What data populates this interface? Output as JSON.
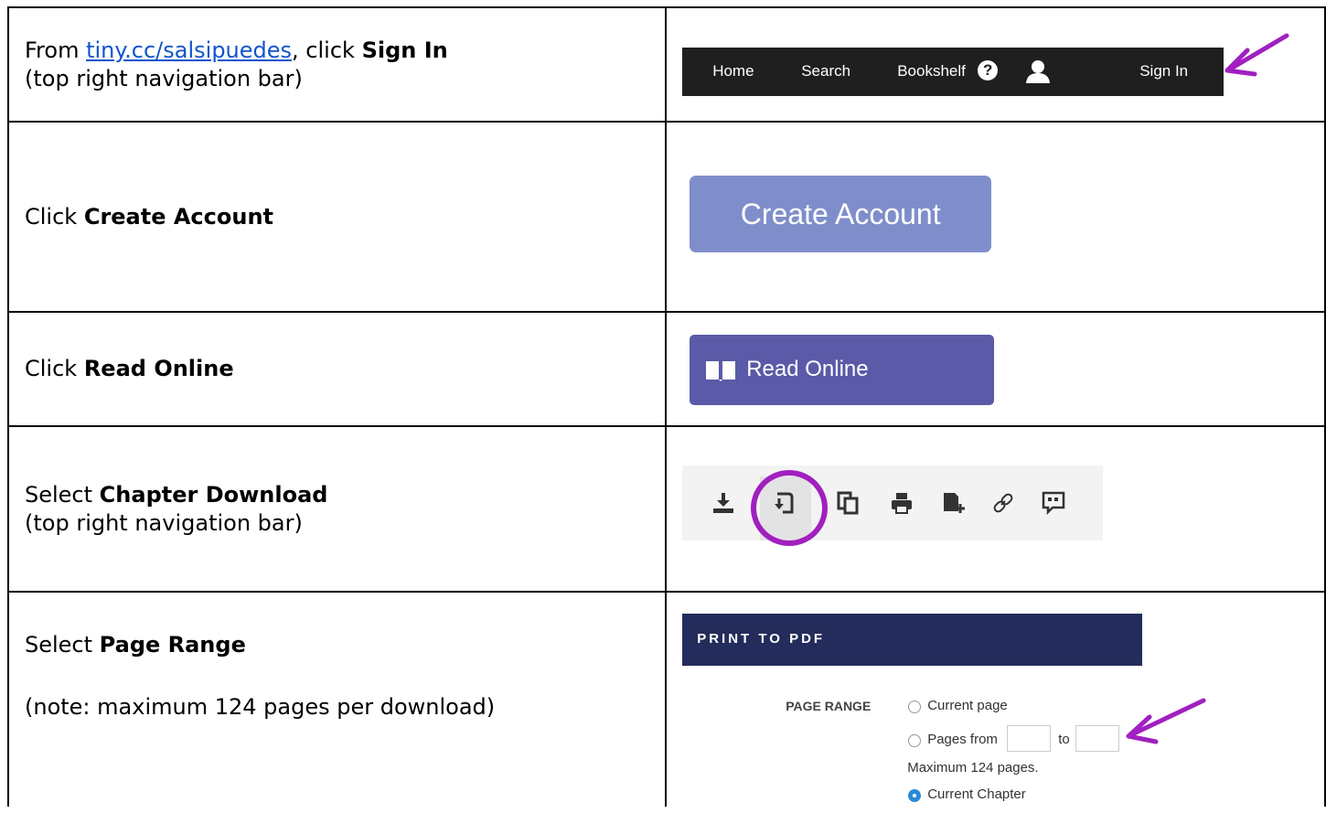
{
  "rows": [
    {
      "instruction_prefix": "From ",
      "link_text": "tiny.cc/salsipuedes",
      "instruction_mid": ", click ",
      "instruction_bold": "Sign In",
      "instruction_sub": "(top right navigation bar)"
    },
    {
      "instruction_prefix": "Click ",
      "instruction_bold": "Create Account"
    },
    {
      "instruction_prefix": "Click ",
      "instruction_bold": "Read Online"
    },
    {
      "instruction_prefix": "Select ",
      "instruction_bold": "Chapter Download",
      "instruction_sub": "(top right navigation bar)"
    },
    {
      "instruction_prefix": "Select ",
      "instruction_bold": "Page Range",
      "instruction_note": "(note: maximum 124 pages per download)"
    }
  ],
  "navbar": {
    "items": [
      "Home",
      "Search",
      "Bookshelf"
    ],
    "help_icon": "question-circle-icon",
    "user_icon": "user-icon",
    "sign_in": "Sign In",
    "bg_color": "#1f1f1f"
  },
  "create_account": {
    "label": "Create Account",
    "color": "#7f8ecb"
  },
  "read_online": {
    "label": "Read Online",
    "icon": "book-icon",
    "color": "#5a5aa8"
  },
  "toolbar": {
    "icons": [
      "download-icon",
      "chapter-download-icon",
      "copy-icon",
      "print-icon",
      "add-note-icon",
      "link-icon",
      "quote-icon"
    ],
    "active": "chapter-download-icon",
    "highlight_color": "#a020c0"
  },
  "print_to_pdf": {
    "title": "PRINT TO PDF",
    "page_range_label": "PAGE RANGE",
    "options": {
      "current_page": "Current page",
      "pages_from": "Pages from",
      "to": "to",
      "max_note": "Maximum 124 pages.",
      "current_chapter": "Current Chapter"
    },
    "selected": "Current Chapter",
    "header_color": "#232c5a"
  },
  "annotation_color": "#a020c0"
}
